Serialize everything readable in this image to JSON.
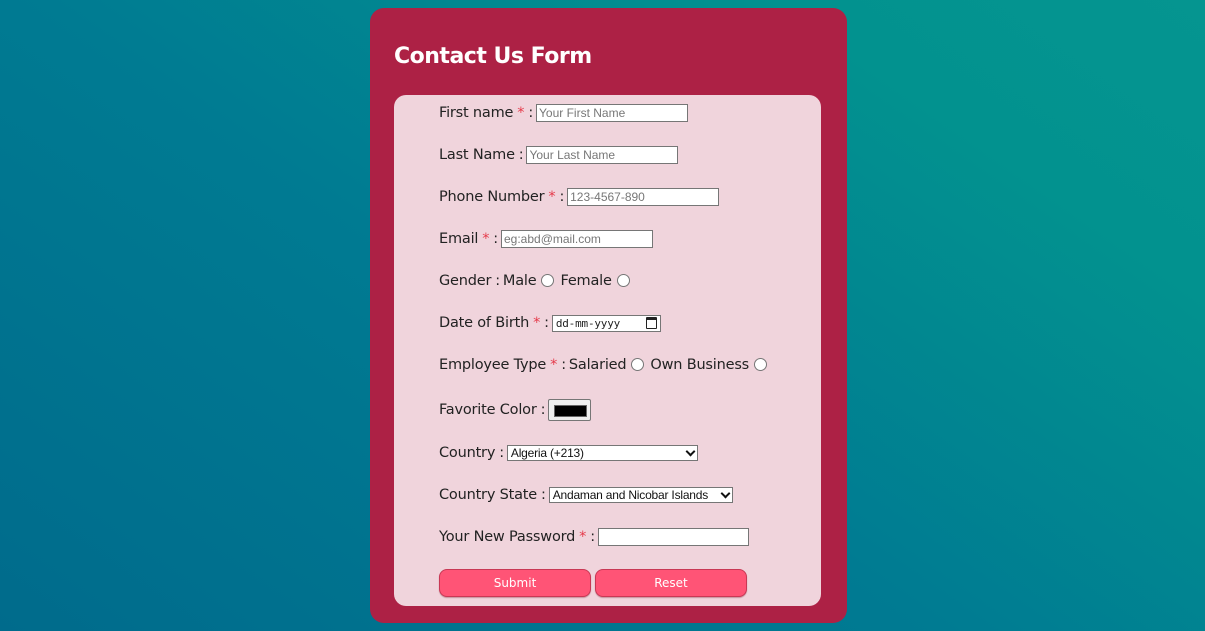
{
  "form": {
    "title": "Contact Us Form",
    "required_marker": "*",
    "colon": ":",
    "fields": {
      "first_name": {
        "label": "First name",
        "required": true,
        "placeholder": "Your First Name",
        "value": ""
      },
      "last_name": {
        "label": "Last Name",
        "required": false,
        "placeholder": "Your Last Name",
        "value": ""
      },
      "phone": {
        "label": "Phone Number",
        "required": true,
        "placeholder": "123-4567-890",
        "value": ""
      },
      "email": {
        "label": "Email",
        "required": true,
        "placeholder": "eg:abd@mail.com",
        "value": ""
      },
      "gender": {
        "label": "Gender",
        "required": false,
        "options": [
          "Male",
          "Female"
        ],
        "selected": null
      },
      "dob": {
        "label": "Date of Birth",
        "required": true,
        "placeholder": "dd-mm-yyyy",
        "icon": "calendar-icon"
      },
      "employee_type": {
        "label": "Employee Type",
        "required": true,
        "options": [
          "Salaried",
          "Own Business"
        ],
        "selected": null
      },
      "favorite_color": {
        "label": "Favorite Color",
        "required": false,
        "value": "#000000"
      },
      "country": {
        "label": "Country",
        "required": false,
        "selected": "Algeria (+213)"
      },
      "country_state": {
        "label": "Country State",
        "required": false,
        "selected": "Andaman and Nicobar Islands"
      },
      "password": {
        "label": "Your New Password",
        "required": true,
        "value": ""
      }
    },
    "buttons": {
      "submit": "Submit",
      "reset": "Reset"
    }
  },
  "colors": {
    "card": "#ad2145",
    "panel": "#f0d4dc",
    "button": "#ff5476",
    "required": "#e53a4a",
    "background_start": "#006b8c",
    "background_end": "#059590"
  }
}
